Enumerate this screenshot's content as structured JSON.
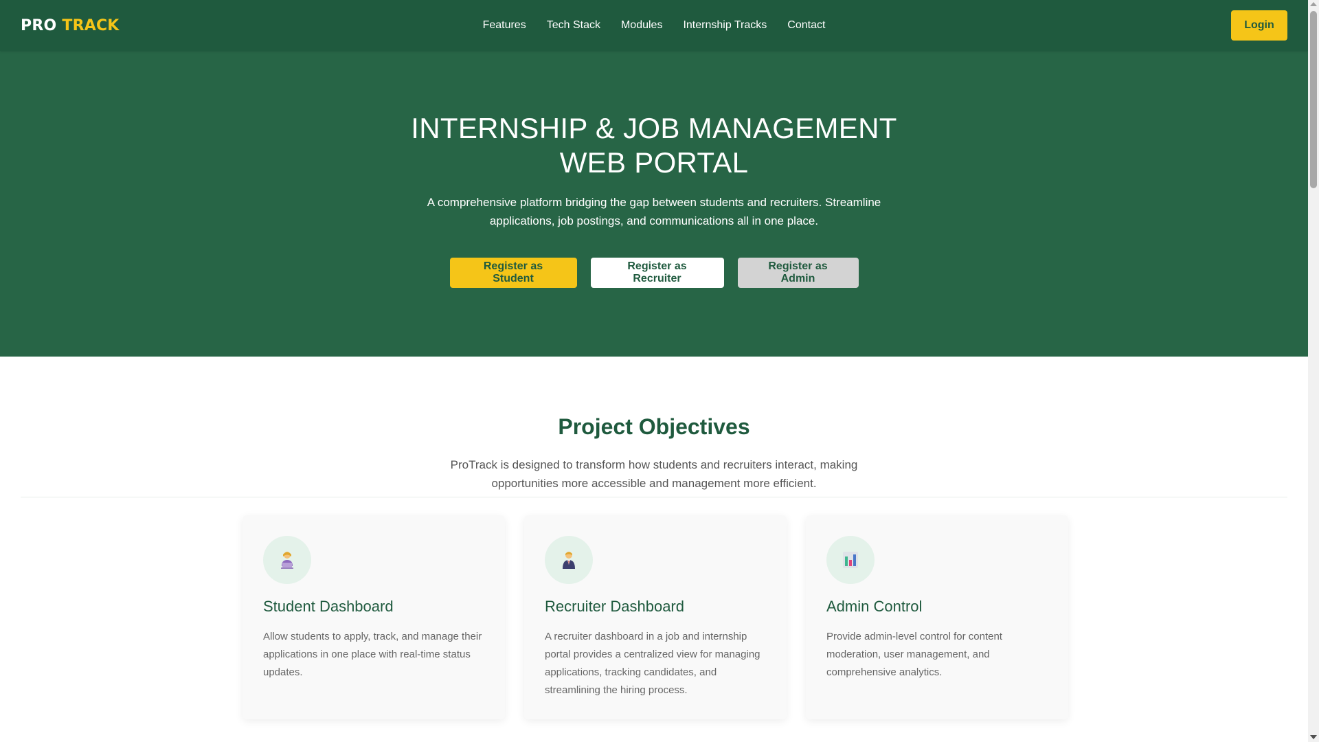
{
  "nav": {
    "logo_part1": "PRO",
    "logo_part2": "TRACK",
    "links": [
      "Features",
      "Tech Stack",
      "Modules",
      "Internship Tracks",
      "Contact"
    ],
    "login_label": "Login"
  },
  "hero": {
    "title": "INTERNSHIP & JOB MANAGEMENT WEB PORTAL",
    "subtitle": "A comprehensive platform bridging the gap between students and recruiters. Streamline applications, job postings, and communications all in one place.",
    "buttons": {
      "student": "Register as Student",
      "recruiter": "Register as Recruiter",
      "admin": "Register as Admin"
    }
  },
  "objectives": {
    "title": "Project Objectives",
    "subtitle": "ProTrack is designed to transform how students and recruiters interact, making opportunities more accessible and management more efficient.",
    "cards": [
      {
        "icon": "student-at-laptop-icon",
        "icon_glyph": "👩‍💻",
        "title": "Student Dashboard",
        "description": "Allow students to apply, track, and manage their applications in one place with real-time status updates."
      },
      {
        "icon": "recruiter-in-suit-icon",
        "icon_glyph": "👨‍💼",
        "title": "Recruiter Dashboard",
        "description": "A recruiter dashboard in a job and internship portal provides a centralized view for managing applications, tracking candidates, and streamlining the hiring process."
      },
      {
        "icon": "bar-chart-icon",
        "icon_glyph": "📊",
        "title": "Admin Control",
        "description": "Provide admin-level control for content moderation, user management, and comprehensive analytics."
      }
    ]
  },
  "colors": {
    "nav_bg": "#1f5a3e",
    "hero_bg": "#276546",
    "accent_yellow": "#f5c518",
    "heading_green": "#1f5a3e"
  }
}
